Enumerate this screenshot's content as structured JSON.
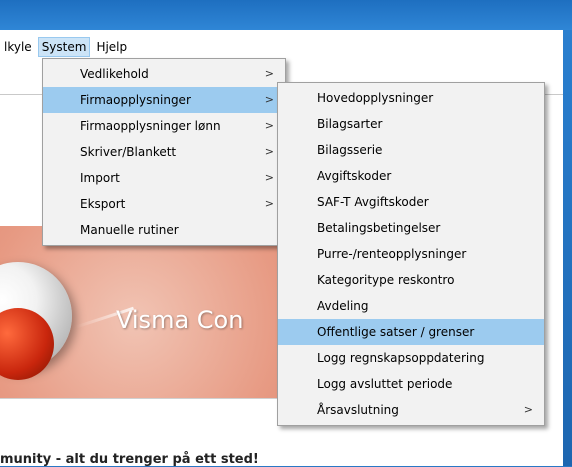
{
  "menubar": {
    "items": [
      {
        "label": "lkyle",
        "active": false
      },
      {
        "label": "System",
        "active": true
      },
      {
        "label": "Hjelp",
        "active": false
      }
    ]
  },
  "system_menu": {
    "items": [
      {
        "label": "Vedlikehold",
        "submenu": true
      },
      {
        "label": "Firmaopplysninger",
        "submenu": true,
        "highlighted": true
      },
      {
        "label": "Firmaopplysninger lønn",
        "submenu": true
      },
      {
        "label": "Skriver/Blankett",
        "submenu": true
      },
      {
        "label": "Import",
        "submenu": true
      },
      {
        "label": "Eksport",
        "submenu": true
      },
      {
        "label": "Manuelle rutiner",
        "submenu": false
      }
    ]
  },
  "firma_menu": {
    "items": [
      {
        "label": "Hovedopplysninger",
        "submenu": false
      },
      {
        "label": "Bilagsarter",
        "submenu": false
      },
      {
        "label": "Bilagsserie",
        "submenu": false
      },
      {
        "label": "Avgiftskoder",
        "submenu": false
      },
      {
        "label": "SAF-T Avgiftskoder",
        "submenu": false
      },
      {
        "label": "Betalingsbetingelser",
        "submenu": false
      },
      {
        "label": "Purre-/renteopplysninger",
        "submenu": false
      },
      {
        "label": "Kategoritype reskontro",
        "submenu": false
      },
      {
        "label": "Avdeling",
        "submenu": false
      },
      {
        "label": "Offentlige satser / grenser",
        "submenu": false,
        "highlighted": true
      },
      {
        "label": "Logg regnskapsoppdatering",
        "submenu": false
      },
      {
        "label": "Logg avsluttet periode",
        "submenu": false
      },
      {
        "label": "Årsavslutning",
        "submenu": true
      }
    ]
  },
  "banner": {
    "title": "Visma Con"
  },
  "community": {
    "text": "munity - alt du trenger på ett sted!"
  },
  "icons": {
    "submenu_arrow": "chevron-right-icon",
    "submenu_glyph": ">"
  },
  "colors": {
    "highlight": "#9ccbef",
    "menubar_active": "#cce4f7",
    "desktop": "#2a78c6"
  }
}
